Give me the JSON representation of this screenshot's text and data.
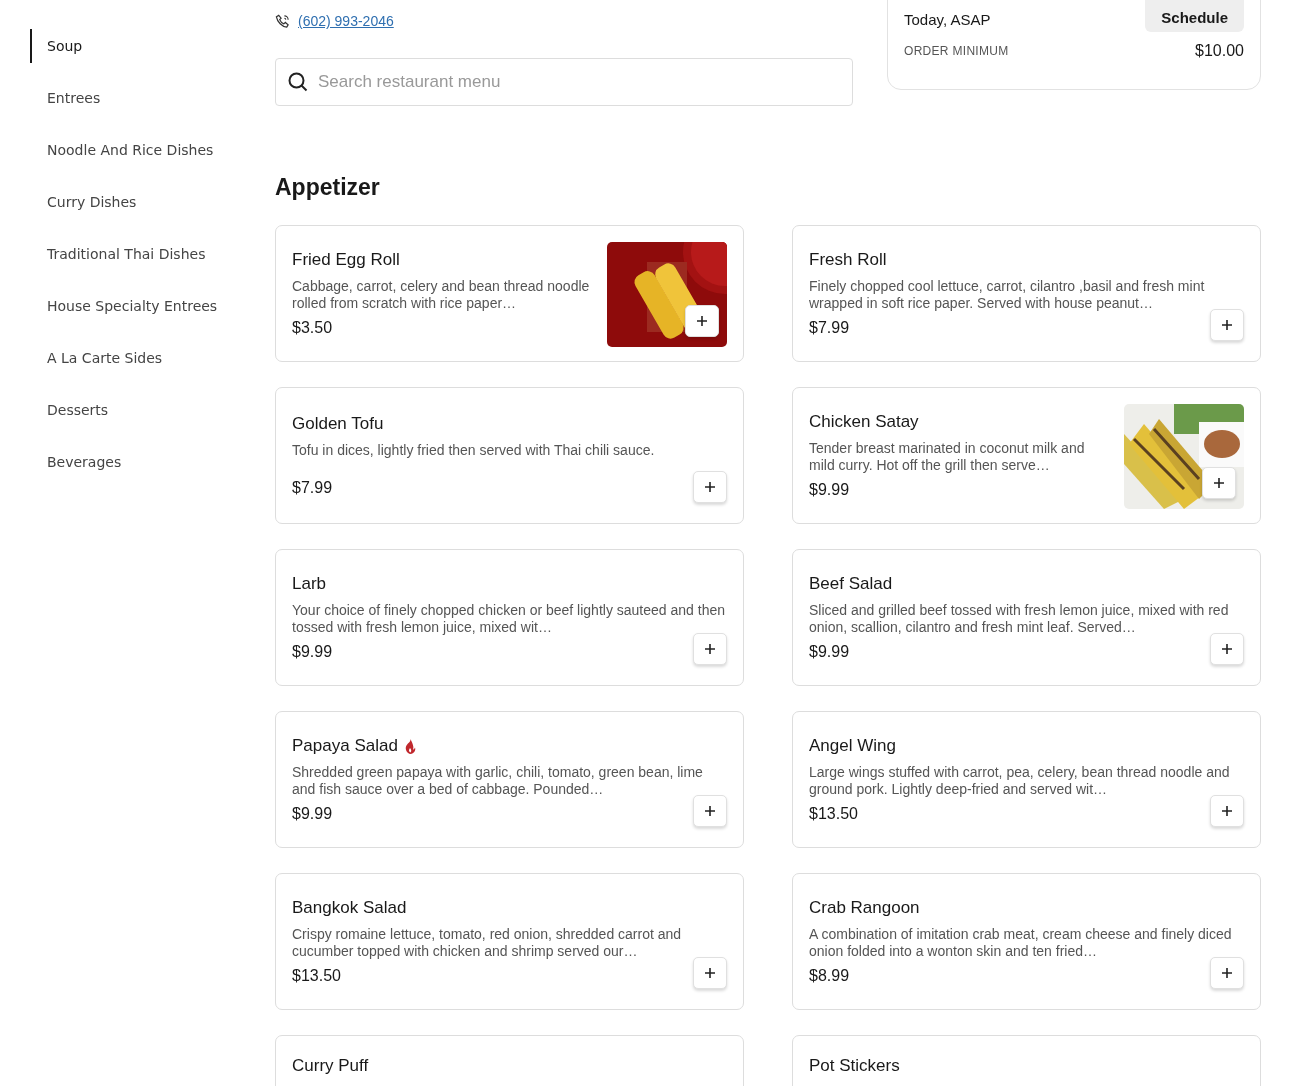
{
  "sidebar": {
    "items": [
      {
        "label": "Soup",
        "selected": true
      },
      {
        "label": "Entrees",
        "selected": false
      },
      {
        "label": "Noodle And Rice Dishes",
        "selected": false
      },
      {
        "label": "Curry Dishes",
        "selected": false
      },
      {
        "label": "Traditional Thai Dishes",
        "selected": false
      },
      {
        "label": "House Specialty Entrees",
        "selected": false
      },
      {
        "label": "A La Carte Sides",
        "selected": false
      },
      {
        "label": "Desserts",
        "selected": false
      },
      {
        "label": "Beverages",
        "selected": false
      }
    ]
  },
  "phone": "(602) 993-2046",
  "search": {
    "placeholder": "Search restaurant menu"
  },
  "order_card": {
    "schedule_button": "Schedule",
    "time": "Today, ASAP",
    "minimum_label": "ORDER MINIMUM",
    "minimum_value": "$10.00"
  },
  "section": {
    "title": "Appetizer",
    "items": [
      {
        "name": "Fried Egg Roll",
        "description": "Cabbage, carrot, celery and bean thread noodle rolled from scratch with rice paper…",
        "price": "$3.50",
        "spicy": false
      },
      {
        "name": "Fresh Roll",
        "description": "Finely chopped cool lettuce, carrot, cilantro ,basil and fresh mint wrapped in soft rice paper. Served with house peanut…",
        "price": "$7.99",
        "spicy": false
      },
      {
        "name": "Golden Tofu",
        "description": "Tofu in dices, lightly fried then served with Thai chili sauce.",
        "price": "$7.99",
        "spicy": false
      },
      {
        "name": "Chicken Satay",
        "description": "Tender breast marinated in coconut milk and mild curry. Hot off the grill then serve…",
        "price": "$9.99",
        "spicy": false
      },
      {
        "name": "Larb",
        "description": "Your choice of finely chopped chicken or beef lightly sauteed and then tossed with fresh lemon juice, mixed wit…",
        "price": "$9.99",
        "spicy": false
      },
      {
        "name": "Beef Salad",
        "description": "Sliced and grilled beef tossed with fresh lemon juice, mixed with red onion, scallion, cilantro and fresh mint leaf. Served…",
        "price": "$9.99",
        "spicy": false
      },
      {
        "name": "Papaya Salad",
        "description": "Shredded green papaya with garlic, chili, tomato, green bean, lime and fish sauce over a bed of cabbage. Pounded…",
        "price": "$9.99",
        "spicy": true
      },
      {
        "name": "Angel Wing",
        "description": "Large wings stuffed with carrot, pea, celery, bean thread noodle and ground pork. Lightly deep-fried and served wit…",
        "price": "$13.50",
        "spicy": false
      },
      {
        "name": "Bangkok Salad",
        "description": "Crispy romaine lettuce, tomato, red onion, shredded carrot and cucumber topped with chicken and shrimp served our…",
        "price": "$13.50",
        "spicy": false
      },
      {
        "name": "Crab Rangoon",
        "description": "A combination of imitation crab meat, cream cheese and finely diced onion folded into a wonton skin and ten fried…",
        "price": "$8.99",
        "spicy": false
      },
      {
        "name": "Curry Puff",
        "spicy": false
      },
      {
        "name": "Pot Stickers",
        "spicy": false
      }
    ]
  }
}
